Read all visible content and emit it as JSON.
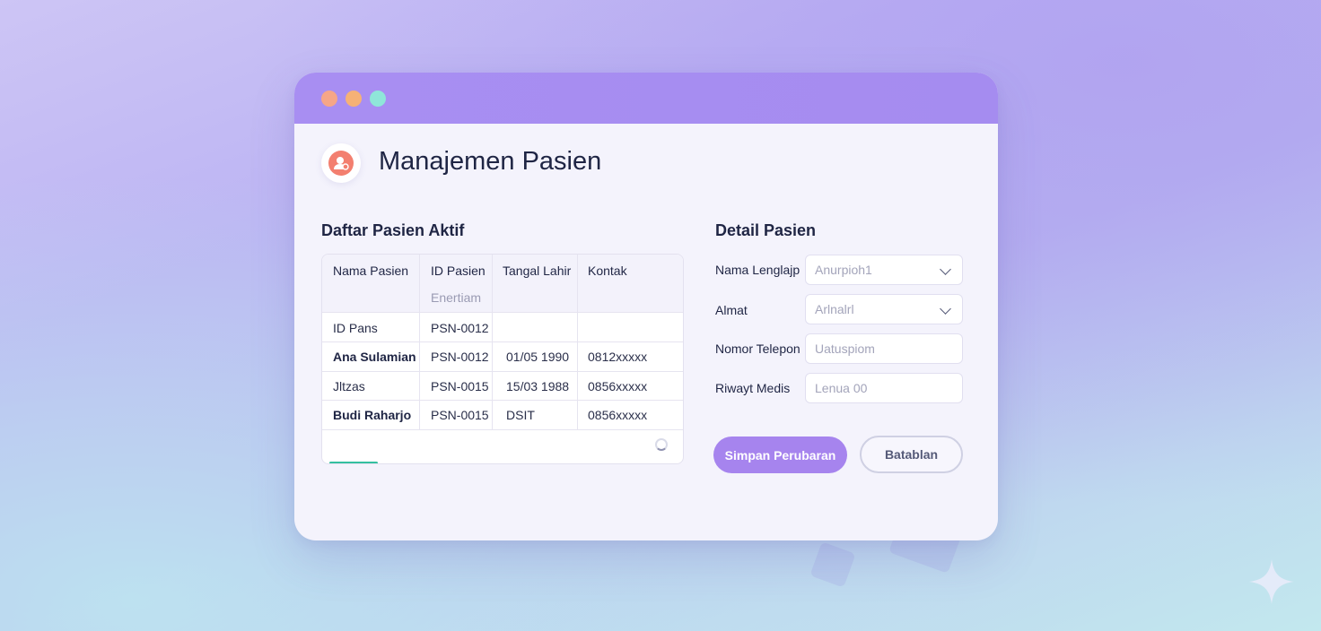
{
  "window": {
    "title": "Manajemen Pasien"
  },
  "patient_list": {
    "title": "Daftar Pasien Aktif",
    "columns": [
      "Nama Pasien",
      "ID Pasien",
      "Tangal Lahir",
      "Kontak"
    ],
    "sub_header": "Enertiam",
    "rows": [
      {
        "name": "ID Pans",
        "id": "PSN-0012",
        "dob": "",
        "contact": ""
      },
      {
        "name": "Ana Sulamian",
        "id": "PSN-0012",
        "dob": "01/05 1990",
        "contact": "0812xxxxx"
      },
      {
        "name": "Jltzas",
        "id": "PSN-0015",
        "dob": "15/03 1988",
        "contact": "0856xxxxx"
      },
      {
        "name": "Budi Raharjo",
        "id": "PSN-0015",
        "dob": "DSIT",
        "contact": "0856xxxxx"
      }
    ],
    "load_progress": 0.14
  },
  "detail": {
    "title": "Detail Pasien",
    "fields": [
      {
        "label": "Nama Lenglajp",
        "placeholder": "Anurpioh1",
        "type": "select"
      },
      {
        "label": "Almat",
        "placeholder": "Arlnalrl",
        "type": "select"
      },
      {
        "label": "Nomor Telepon",
        "placeholder": "Uatuspiom",
        "type": "text"
      },
      {
        "label": "Riwayt Medis",
        "placeholder": "Lenua 00",
        "type": "text"
      }
    ],
    "save_label": "Simpan Perubaran",
    "cancel_label": "Batablan"
  },
  "colors": {
    "accent": "#a684ee",
    "titlebar": "#a88ef2",
    "progress": "#34bfa0",
    "icon": "#f37f6f"
  },
  "icons": {
    "app": "user-icon",
    "chevron": "chevron-down-icon",
    "spinner": "loading-spinner-icon",
    "sparkle": "sparkle-icon"
  }
}
